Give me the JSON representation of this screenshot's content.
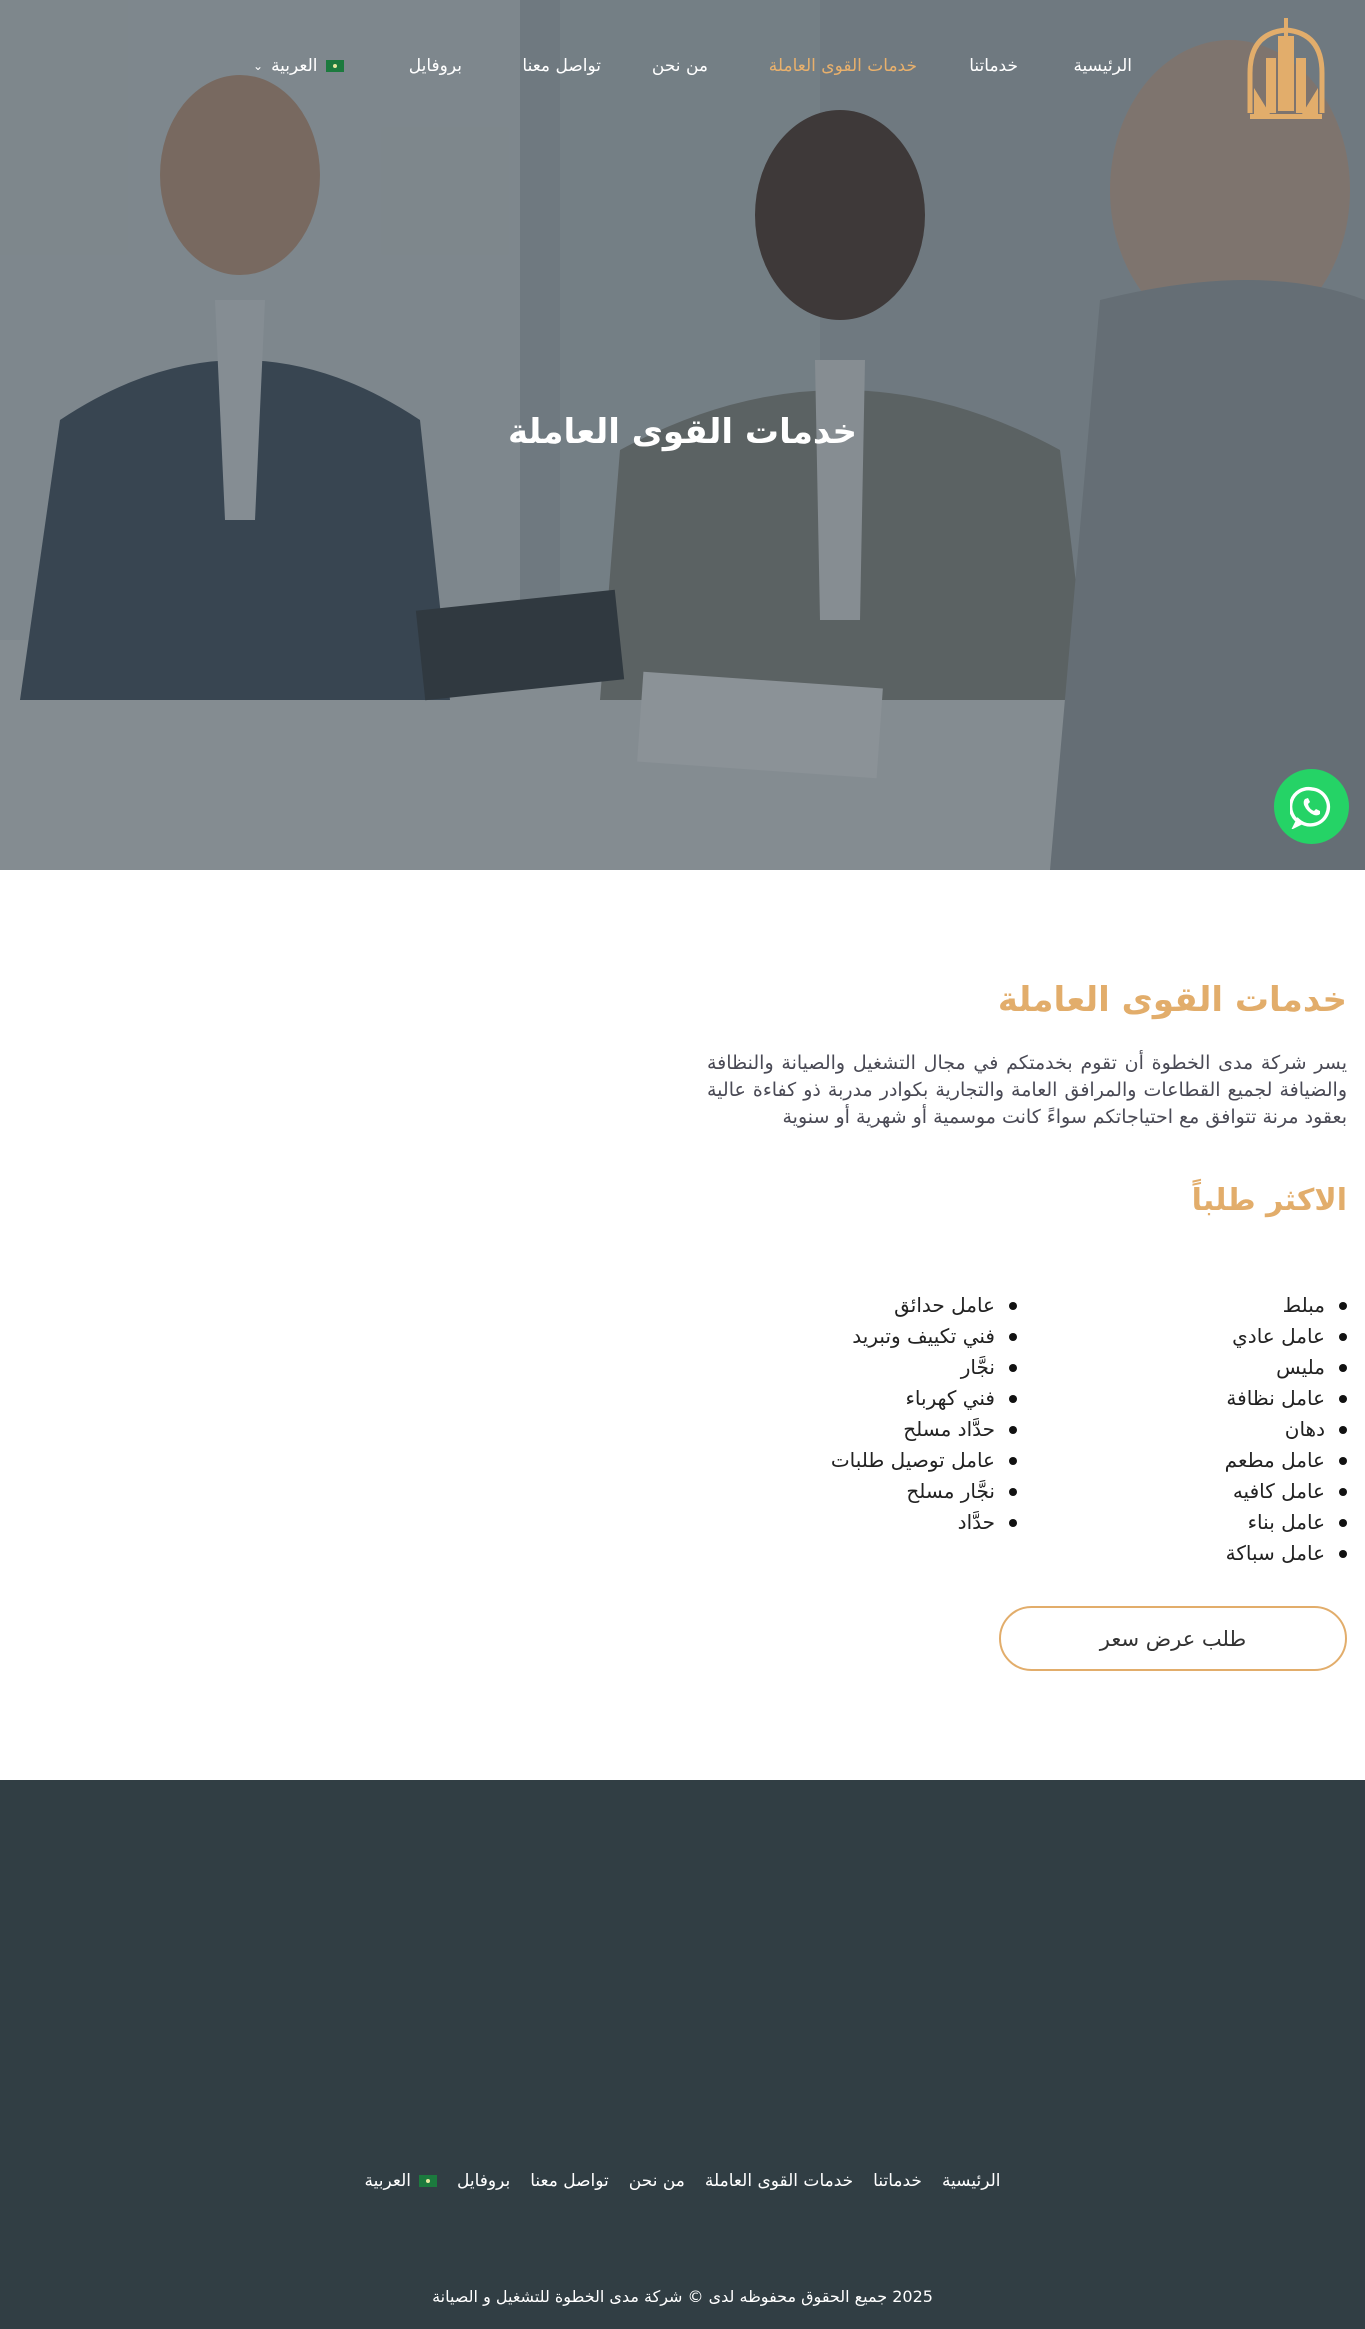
{
  "nav": {
    "items": [
      {
        "label": "الرئيسية",
        "active": false
      },
      {
        "label": "خدماتنا",
        "active": false
      },
      {
        "label": "خدمات القوى العاملة",
        "active": true
      },
      {
        "label": "من نحن",
        "active": false
      },
      {
        "label": "تواصل معنا",
        "active": false
      },
      {
        "label": "بروفايل",
        "active": false
      }
    ],
    "language": "العربية"
  },
  "hero": {
    "title": "خدمات القوى العاملة"
  },
  "main": {
    "heading": "خدمات القوى العاملة",
    "intro": "يسر شركة مدى الخطوة أن تقوم بخدمتكم في مجال التشغيل والصيانة والنظافة والضيافة لجميع القطاعات والمرافق العامة والتجارية بكوادر مدربة ذو كفاءة عالية بعقود مرنة تتوافق مع احتياجاتكم سواءً كانت موسمية أو شهرية أو سنوية",
    "most_requested_heading": "الاكثر طلباً",
    "list_right": [
      "مبلط",
      "عامل عادي",
      "مليس",
      "عامل نظافة",
      "دهان",
      "عامل مطعم",
      "عامل كافيه",
      "عامل بناء",
      "عامل سباكة"
    ],
    "list_left": [
      "عامل حدائق",
      "فني تكييف وتبريد",
      "نجَّار",
      "فني كهرباء",
      "حدَّاد مسلح",
      "عامل توصيل طلبات",
      "نجَّار مسلح",
      "حدَّاد"
    ],
    "quote_button": "طلب عرض سعر"
  },
  "footer": {
    "links": [
      "الرئيسية",
      "خدماتنا",
      "خدمات القوى العاملة",
      "من نحن",
      "تواصل معنا",
      "بروفايل"
    ],
    "language": "العربية",
    "copyright": "2025 جميع الحقوق محفوظه لدى © شركة مدى الخطوة للتشغيل و الصيانة"
  },
  "colors": {
    "accent": "#e2ad6b",
    "footer_bg": "#313e44",
    "whatsapp": "#25d366",
    "hero_overlay": "#34424a"
  },
  "icons": {
    "logo": "building-logo-icon",
    "whatsapp": "whatsapp-icon",
    "language_flag": "saudi-flag-icon",
    "dropdown": "chevron-down-icon"
  }
}
